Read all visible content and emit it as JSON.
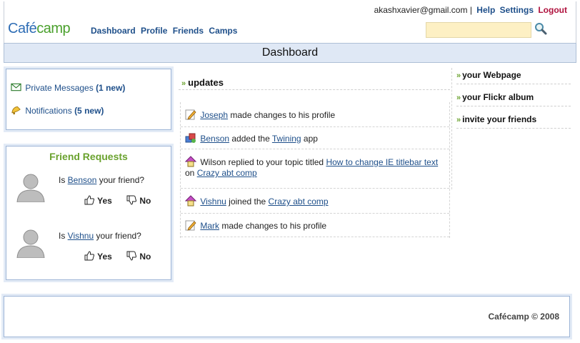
{
  "top": {
    "email": "akashxavier@gmail.com",
    "separator": "|",
    "help": "Help",
    "settings": "Settings",
    "logout": "Logout"
  },
  "logo": {
    "part1": "Café",
    "part2": "camp"
  },
  "nav": [
    "Dashboard",
    "Profile",
    "Friends",
    "Camps"
  ],
  "search": {
    "value": "",
    "placeholder": ""
  },
  "page_title": "Dashboard",
  "messages": {
    "private_label": "Private Messages",
    "private_count": "(1 new)",
    "notifications_label": "Notifications",
    "notifications_count": "(5 new)"
  },
  "friend_requests": {
    "title": "Friend Requests",
    "items": [
      {
        "pre": "Is ",
        "name": "Benson",
        "post": " your friend?",
        "yes": "Yes",
        "no": "No"
      },
      {
        "pre": "Is ",
        "name": "Vishnu",
        "post": " your friend?",
        "yes": "Yes",
        "no": "No"
      }
    ]
  },
  "updates": {
    "title": "updates",
    "chevron": "»",
    "items": [
      {
        "icon": "pencil-icon",
        "link1": "Joseph",
        "text1": " made changes to his profile"
      },
      {
        "icon": "app-icon",
        "link1": "Benson",
        "text1": " added the ",
        "link2": "Twining",
        "text2": " app"
      },
      {
        "icon": "topic-icon",
        "text0": "Wilson replied to your topic titled ",
        "link1": "How to change IE titlebar text",
        "text1": " on ",
        "link2": "Crazy abt comp"
      },
      {
        "icon": "topic-icon",
        "link1": "Vishnu",
        "text1": " joined the ",
        "link2": "Crazy abt comp"
      },
      {
        "icon": "pencil-icon",
        "link1": "Mark",
        "text1": " made changes to his profile"
      }
    ]
  },
  "right_links": [
    {
      "chevron": "»",
      "label": "your Webpage"
    },
    {
      "chevron": "»",
      "label": "your Flickr album"
    },
    {
      "chevron": "»",
      "label": "invite your friends"
    }
  ],
  "footer": {
    "text": "Cafécamp © 2008"
  }
}
